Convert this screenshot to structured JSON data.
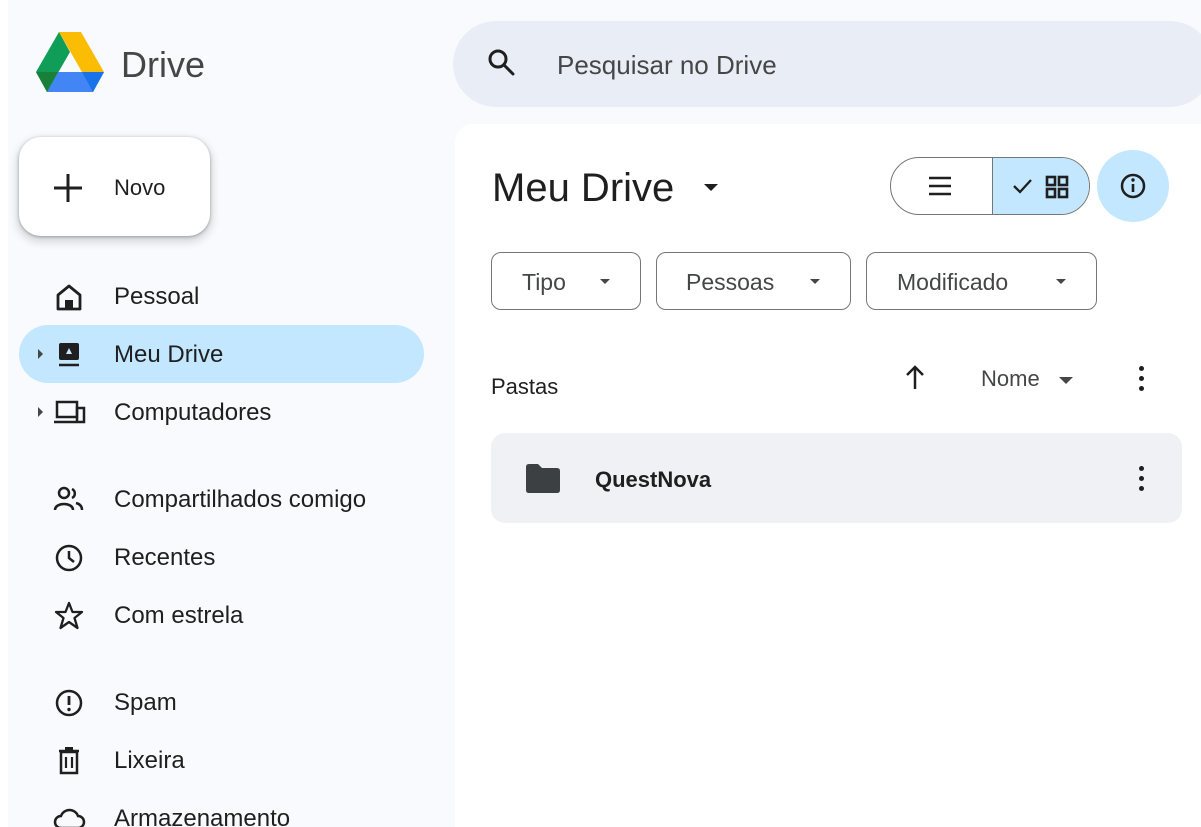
{
  "header": {
    "brand": "Drive",
    "search_placeholder": "Pesquisar no Drive"
  },
  "new_button": {
    "label": "Novo"
  },
  "sidebar": {
    "items": [
      {
        "label": "Pessoal",
        "icon": "home-icon",
        "active": false
      },
      {
        "label": "Meu Drive",
        "icon": "my-drive-icon",
        "active": true
      },
      {
        "label": "Computadores",
        "icon": "computers-icon",
        "active": false
      },
      {
        "label": "Compartilhados comigo",
        "icon": "people-icon",
        "active": false
      },
      {
        "label": "Recentes",
        "icon": "clock-icon",
        "active": false
      },
      {
        "label": "Com estrela",
        "icon": "star-icon",
        "active": false
      },
      {
        "label": "Spam",
        "icon": "spam-icon",
        "active": false
      },
      {
        "label": "Lixeira",
        "icon": "trash-icon",
        "active": false
      },
      {
        "label": "Armazenamento",
        "icon": "cloud-icon",
        "active": false
      }
    ]
  },
  "main": {
    "title": "Meu Drive",
    "view_mode": "grid",
    "filters": [
      "Tipo",
      "Pessoas",
      "Modificado"
    ],
    "section_label": "Pastas",
    "sort_label": "Nome",
    "folders": [
      {
        "name": "QuestNova"
      }
    ]
  },
  "colors": {
    "active_nav": "#c2e7ff",
    "background": "#f8fafd",
    "search_bg": "#e9eef6"
  }
}
